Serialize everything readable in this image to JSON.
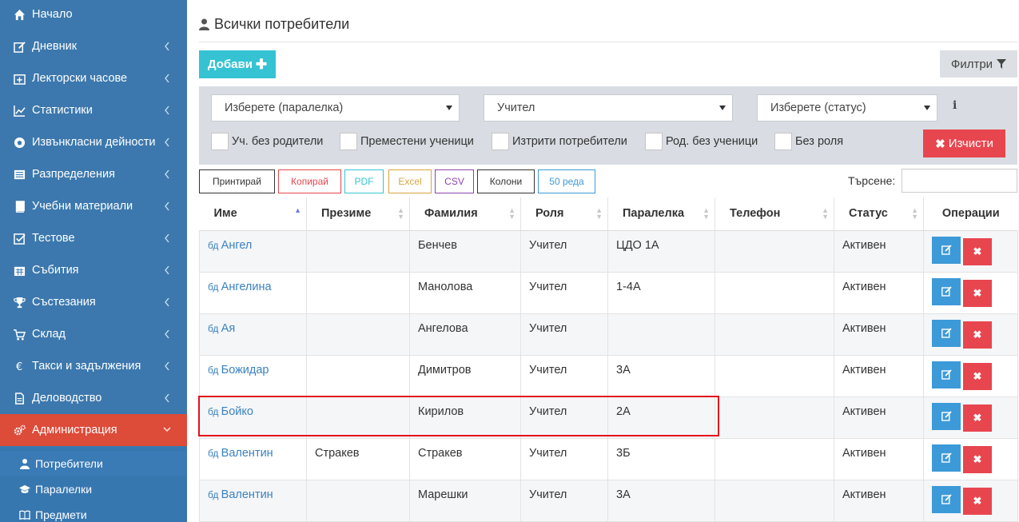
{
  "sidebar": {
    "items": [
      {
        "label": "Начало",
        "icon": "home-icon",
        "chevron": false
      },
      {
        "label": "Дневник",
        "icon": "edit-icon",
        "chevron": true
      },
      {
        "label": "Лекторски часове",
        "icon": "calendar-plus-icon",
        "chevron": true
      },
      {
        "label": "Статистики",
        "icon": "chart-line-icon",
        "chevron": true
      },
      {
        "label": "Извънкласни дейности",
        "icon": "soccer-ball-icon",
        "chevron": true
      },
      {
        "label": "Разпределения",
        "icon": "list-icon",
        "chevron": true
      },
      {
        "label": "Учебни материали",
        "icon": "book-icon",
        "chevron": true
      },
      {
        "label": "Тестове",
        "icon": "check-square-icon",
        "chevron": true
      },
      {
        "label": "Събития",
        "icon": "calendar-icon",
        "chevron": true
      },
      {
        "label": "Състезания",
        "icon": "trophy-icon",
        "chevron": true
      },
      {
        "label": "Склад",
        "icon": "cart-icon",
        "chevron": true
      },
      {
        "label": "Такси и задължения",
        "icon": "euro-icon",
        "chevron": true
      },
      {
        "label": "Деловодство",
        "icon": "file-icon",
        "chevron": true
      },
      {
        "label": "Администрация",
        "icon": "cogs-icon",
        "chevron": true,
        "active": true
      }
    ],
    "subitems": [
      {
        "label": "Потребители",
        "icon": "user-icon",
        "active": true
      },
      {
        "label": "Паралелки",
        "icon": "graduation-cap-icon"
      },
      {
        "label": "Предмети",
        "icon": "book-open-icon"
      }
    ]
  },
  "page": {
    "title": "Всички потребители",
    "add_label": "Добави",
    "filter_label": "Филтри"
  },
  "filters": {
    "class_select": "Изберете (паралелка)",
    "role_select": "Учител",
    "status_select": "Изберете (статус)",
    "info": "i",
    "checkboxes": [
      "Уч. без родители",
      "Преместени ученици",
      "Изтрити потребители",
      "Род. без ученици",
      "Без роля"
    ],
    "clear_label": "Изчисти"
  },
  "toolbar": {
    "buttons": [
      "Принтирай",
      "Копирай",
      "PDF",
      "Excel",
      "CSV",
      "Колони",
      "50 реда"
    ],
    "colors": [
      "#333333",
      "#e8464f",
      "#35c3d4",
      "#d9a441",
      "#8e44ad",
      "#333333",
      "#3d9ad8"
    ],
    "search_label": "Търсене:"
  },
  "table": {
    "columns": [
      "Име",
      "Презиме",
      "Фамилия",
      "Роля",
      "Паралелка",
      "Телефон",
      "Статус",
      "Операции"
    ],
    "rows": [
      [
        "Ангел",
        "",
        "Бенчев",
        "Учител",
        "ЦДО 1А",
        "",
        "Активен"
      ],
      [
        "Ангелина",
        "",
        "Манолова",
        "Учител",
        "1-4А",
        "",
        "Активен"
      ],
      [
        "Ая",
        "",
        "Ангелова",
        "Учител",
        "",
        "",
        "Активен"
      ],
      [
        "Божидар",
        "",
        "Димитров",
        "Учител",
        "3А",
        "",
        "Активен"
      ],
      [
        "Бойко",
        "",
        "Кирилов",
        "Учител",
        "2А",
        "",
        "Активен"
      ],
      [
        "Валентин",
        "Стракев",
        "Стракев",
        "Учител",
        "3Б",
        "",
        "Активен"
      ],
      [
        "Валентин",
        "",
        "Марешки",
        "Учител",
        "3А",
        "",
        "Активен"
      ]
    ],
    "name_prefix": "бд"
  }
}
